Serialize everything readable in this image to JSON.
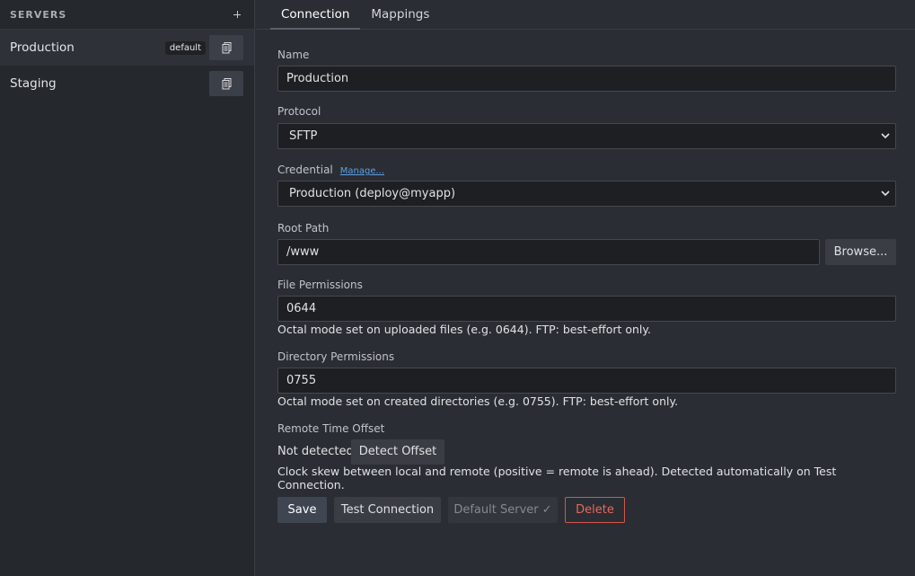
{
  "sidebar": {
    "title": "SERVERS",
    "add_icon": "plus-icon",
    "items": [
      {
        "label": "Production",
        "badge": "default",
        "active": true,
        "icon": "copy-icon"
      },
      {
        "label": "Staging",
        "badge": "",
        "active": false,
        "icon": "copy-icon"
      }
    ]
  },
  "tabs": [
    {
      "label": "Connection",
      "active": true
    },
    {
      "label": "Mappings",
      "active": false
    }
  ],
  "form": {
    "name": {
      "label": "Name",
      "value": "Production"
    },
    "protocol": {
      "label": "Protocol",
      "value": "SFTP"
    },
    "credential": {
      "label": "Credential",
      "link": "Manage...",
      "value": "Production (deploy@myapp)"
    },
    "root_path": {
      "label": "Root Path",
      "value": "/www",
      "browse": "Browse..."
    },
    "file_permissions": {
      "label": "File Permissions",
      "value": "0644",
      "hint": "Octal mode set on uploaded files (e.g. 0644). FTP: best-effort only."
    },
    "dir_permissions": {
      "label": "Directory Permissions",
      "value": "0755",
      "hint": "Octal mode set on created directories (e.g. 0755). FTP: best-effort only."
    },
    "time_offset": {
      "label": "Remote Time Offset",
      "status": "Not detected",
      "detect_button": "Detect Offset",
      "hint": "Clock skew between local and remote (positive = remote is ahead). Detected automatically on Test Connection."
    }
  },
  "actions": {
    "save": "Save",
    "test": "Test Connection",
    "default_server": "Default Server ✓",
    "delete": "Delete"
  },
  "colors": {
    "accent_link": "#5aa0e6",
    "danger": "#e7685b"
  }
}
